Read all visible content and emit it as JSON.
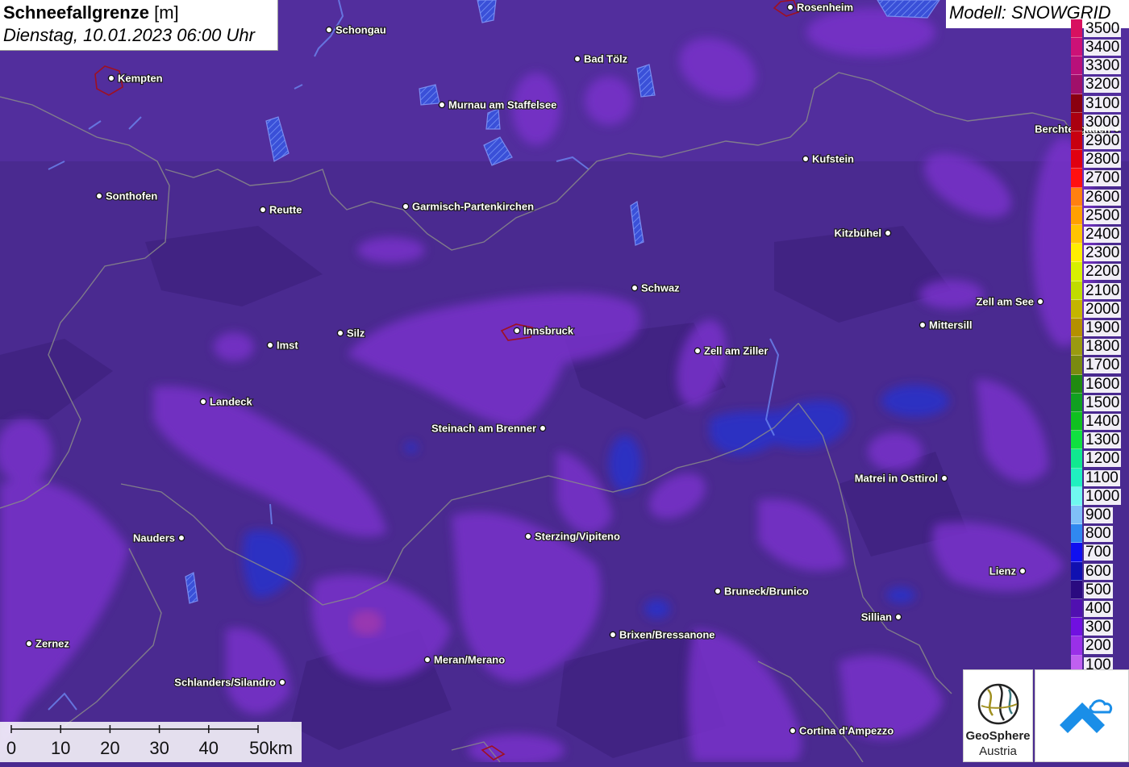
{
  "title": {
    "parameter": "Schneefallgrenze",
    "unit": "[m]",
    "datetime": "Dienstag, 10.01.2023 06:00 Uhr"
  },
  "model": "Modell: SNOWGRID",
  "legend": {
    "top_partial": "3500",
    "entries": [
      {
        "label": "3400",
        "color": "#cc1177"
      },
      {
        "label": "3300",
        "color": "#b8107a"
      },
      {
        "label": "3200",
        "color": "#a0106a"
      },
      {
        "label": "3100",
        "color": "#8a0010"
      },
      {
        "label": "3000",
        "color": "#aa0010"
      },
      {
        "label": "2900",
        "color": "#c80010"
      },
      {
        "label": "2800",
        "color": "#e00010"
      },
      {
        "label": "2700",
        "color": "#ff1010"
      },
      {
        "label": "2600",
        "color": "#ff8010"
      },
      {
        "label": "2500",
        "color": "#ffa000"
      },
      {
        "label": "2400",
        "color": "#ffc400"
      },
      {
        "label": "2300",
        "color": "#ffee00"
      },
      {
        "label": "2200",
        "color": "#d8f000"
      },
      {
        "label": "2100",
        "color": "#c0dc00"
      },
      {
        "label": "2000",
        "color": "#c4b400"
      },
      {
        "label": "1900",
        "color": "#b49000"
      },
      {
        "label": "1800",
        "color": "#9a9a10"
      },
      {
        "label": "1700",
        "color": "#7a8a10"
      },
      {
        "label": "1600",
        "color": "#208a10"
      },
      {
        "label": "1500",
        "color": "#10a020"
      },
      {
        "label": "1400",
        "color": "#10c020"
      },
      {
        "label": "1300",
        "color": "#10e040"
      },
      {
        "label": "1200",
        "color": "#10e890"
      },
      {
        "label": "1100",
        "color": "#20f0c0"
      },
      {
        "label": "1000",
        "color": "#70f8f0"
      },
      {
        "label": "900",
        "color": "#80c0f8"
      },
      {
        "label": "800",
        "color": "#3088f0"
      },
      {
        "label": "700",
        "color": "#1010f0"
      },
      {
        "label": "600",
        "color": "#1010b0"
      },
      {
        "label": "500",
        "color": "#2a0a80"
      },
      {
        "label": "400",
        "color": "#5010b0"
      },
      {
        "label": "300",
        "color": "#7010e0"
      },
      {
        "label": "200",
        "color": "#9a30e8"
      },
      {
        "label": "100",
        "color": "#c060f0"
      }
    ]
  },
  "scale_bar": {
    "labels": [
      "0",
      "10",
      "20",
      "30",
      "40",
      "50km"
    ]
  },
  "logos": {
    "geosphere_name": "GeoSphere",
    "geosphere_sub": "Austria"
  },
  "colors": {
    "base": "#4a2a90",
    "light_band": "#7a30cc",
    "low_blue": "#2a2ec8",
    "border": "#8a8a8a"
  },
  "cities": [
    {
      "name": "Schongau",
      "side": "right"
    },
    {
      "name": "Rosenheim",
      "side": "right"
    },
    {
      "name": "Kempten",
      "side": "right"
    },
    {
      "name": "Bad Tölz",
      "side": "right"
    },
    {
      "name": "Murnau am Staffelsee",
      "side": "right"
    },
    {
      "name": "Berchtesgaden",
      "side": "left"
    },
    {
      "name": "Kufstein",
      "side": "right"
    },
    {
      "name": "Sonthofen",
      "side": "right"
    },
    {
      "name": "Reutte",
      "side": "right"
    },
    {
      "name": "Garmisch-Partenkirchen",
      "side": "right"
    },
    {
      "name": "Kitzbühel",
      "side": "left"
    },
    {
      "name": "Schwaz",
      "side": "right"
    },
    {
      "name": "Zell am See",
      "side": "left"
    },
    {
      "name": "Innsbruck",
      "side": "right"
    },
    {
      "name": "Mittersill",
      "side": "right"
    },
    {
      "name": "Imst",
      "side": "right"
    },
    {
      "name": "Silz",
      "side": "right"
    },
    {
      "name": "Zell am Ziller",
      "side": "right"
    },
    {
      "name": "Landeck",
      "side": "right"
    },
    {
      "name": "Steinach am Brenner",
      "side": "left"
    },
    {
      "name": "Matrei in Osttirol",
      "side": "left"
    },
    {
      "name": "Nauders",
      "side": "left"
    },
    {
      "name": "Sterzing/Vipiteno",
      "side": "right"
    },
    {
      "name": "Lienz",
      "side": "left"
    },
    {
      "name": "Bruneck/Brunico",
      "side": "right"
    },
    {
      "name": "Sillian",
      "side": "left"
    },
    {
      "name": "Brixen/Bressanone",
      "side": "right"
    },
    {
      "name": "Zernez",
      "side": "right"
    },
    {
      "name": "Meran/Merano",
      "side": "right"
    },
    {
      "name": "Schlanders/Silandro",
      "side": "left"
    },
    {
      "name": "Cortina d'Ampezzo",
      "side": "right"
    }
  ]
}
